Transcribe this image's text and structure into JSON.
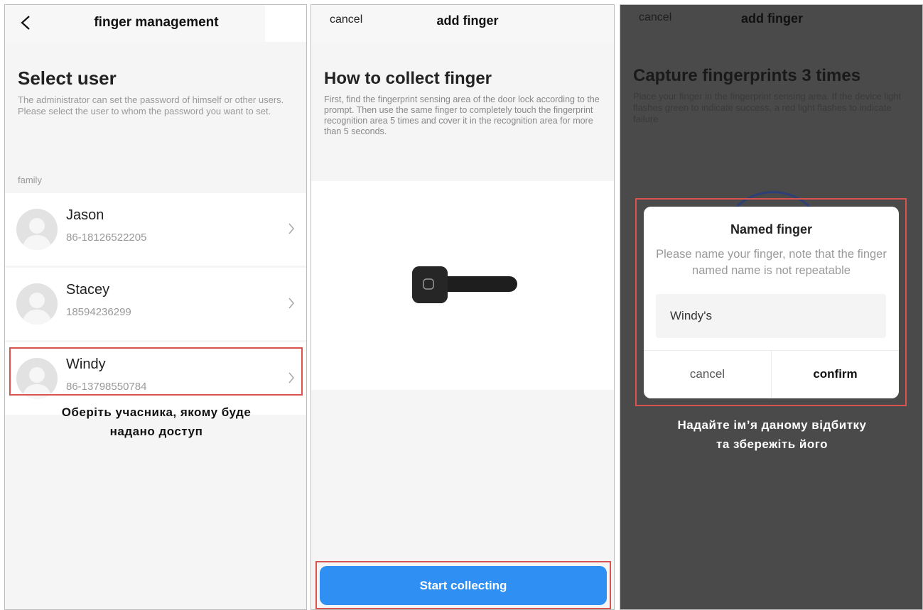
{
  "panel1": {
    "title": "finger management",
    "heading": "Select user",
    "description": "The administrator can set the password of himself or other users. Please select the user to whom the password you want to set.",
    "section_label": "family",
    "users": [
      {
        "name": "Jason",
        "phone": "86-18126522205"
      },
      {
        "name": "Stacey",
        "phone": "18594236299"
      },
      {
        "name": "Windy",
        "phone": "86-13798550784"
      }
    ],
    "caption_line1": "Оберіть учасника, якому буде",
    "caption_line2": "надано доступ"
  },
  "panel2": {
    "cancel": "cancel",
    "title": "add finger",
    "heading": "How to collect finger",
    "description": "First, find the fingerprint sensing area of the door lock according to the prompt. Then use the same finger to completely touch the fingerprint recognition area 5 times and cover it in the recognition area for more than 5 seconds.",
    "button": "Start collecting"
  },
  "panel3": {
    "cancel": "cancel",
    "title": "add finger",
    "heading": "Capture fingerprints 3 times",
    "description": "Place your finger in the fingerprint sensing area. If the device light flashes green to indicate success, a red light flashes to indicate failure",
    "dialog": {
      "title": "Named finger",
      "message": "Please name your finger, note that the finger named name is not repeatable",
      "input_value": "Windy's",
      "cancel": "cancel",
      "confirm": "confirm"
    },
    "caption_line1": "Надайте ім’я даному відбитку",
    "caption_line2": "та збережіть його"
  },
  "colors": {
    "accent": "#2f8ff3",
    "highlight": "#d9534f",
    "overlay": "#4a4a4a"
  }
}
